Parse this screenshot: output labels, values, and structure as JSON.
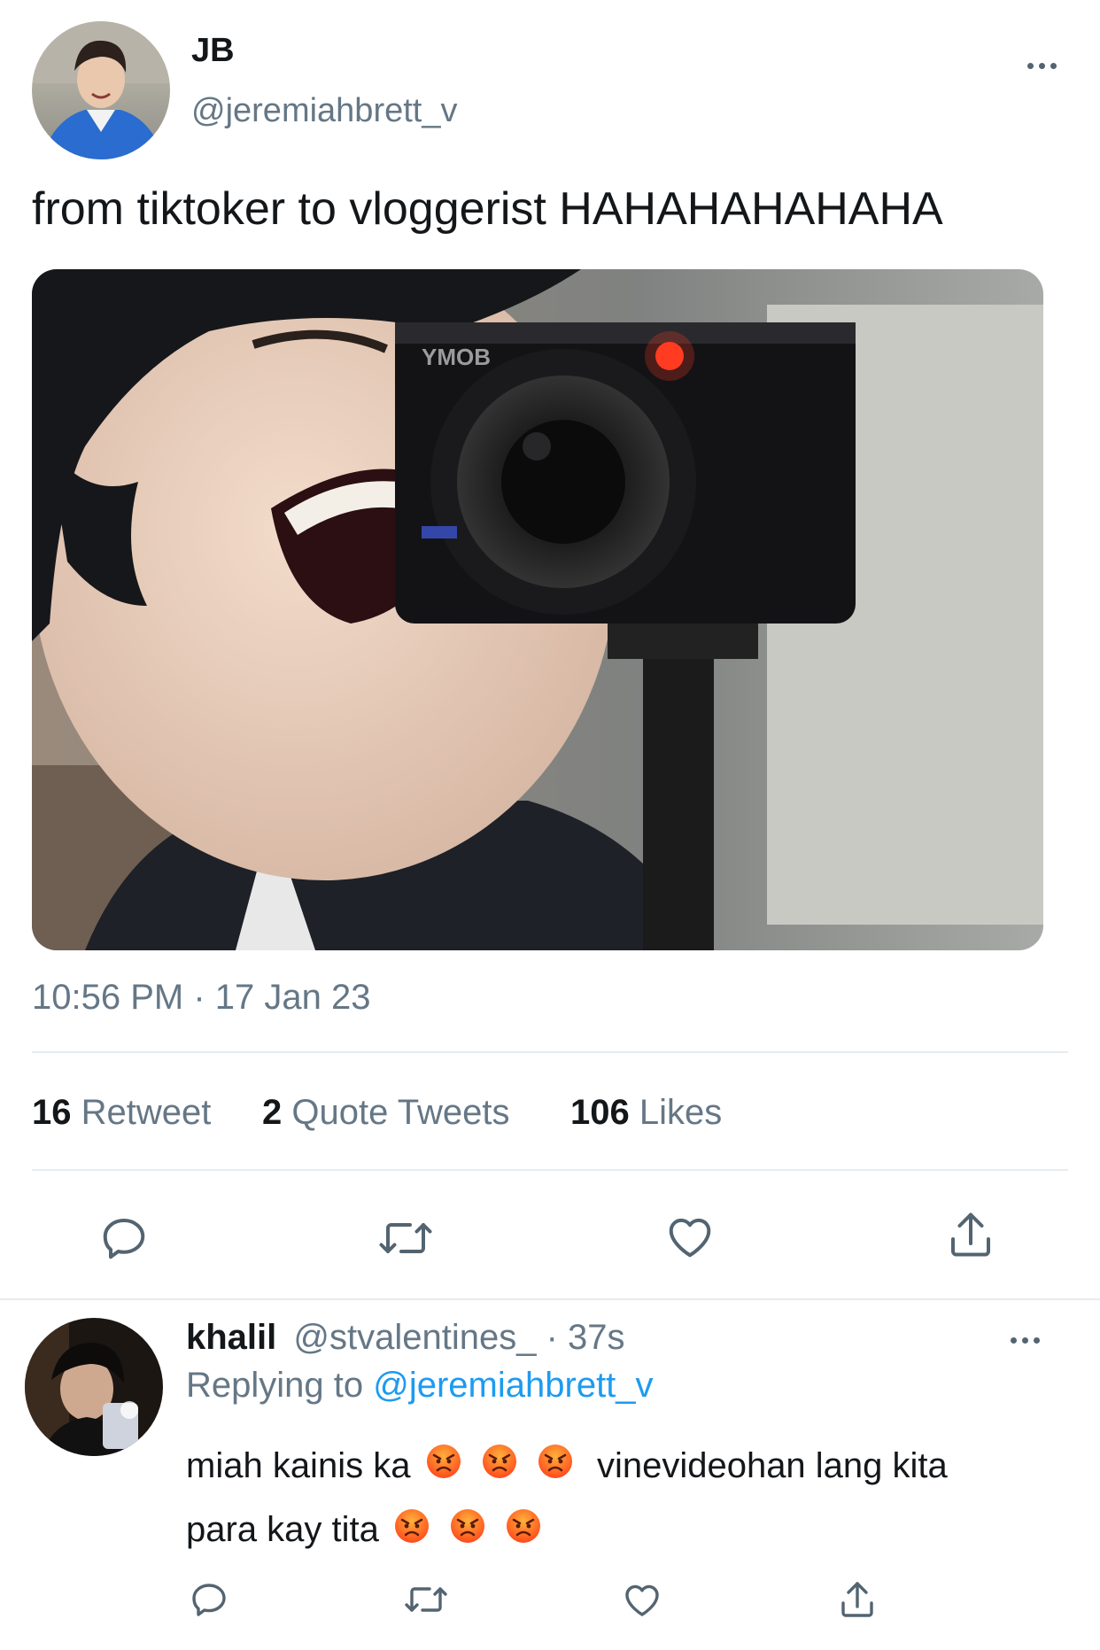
{
  "tweet": {
    "display_name": "JB",
    "handle": "@jeremiahbrett_v",
    "text": "from tiktoker to vloggerist HAHAHAHAHAHA",
    "camera_brand": "YMOB",
    "timestamp": "10:56 PM · 17 Jan 23",
    "stats": {
      "retweets_count": "16",
      "retweets_label": "Retweet",
      "quotes_count": "2",
      "quotes_label": "Quote Tweets",
      "likes_count": "106",
      "likes_label": "Likes"
    }
  },
  "reply": {
    "display_name": "khalil",
    "handle": "@stvalentines_",
    "time": "· 37s",
    "replying_prefix": "Replying to",
    "replying_handle": "@jeremiahbrett_v",
    "line1_start": "miah kainis ka",
    "line1_end": "vinevideohan lang kita",
    "line2_start": "para kay tita"
  },
  "icons": [
    "reply-icon",
    "retweet-icon",
    "like-icon",
    "share-icon",
    "more-icon",
    "angry-face-icon"
  ],
  "colors": {
    "text": "#14171a",
    "secondary": "#657786",
    "link": "#1d9bf0",
    "divider": "#e6ecf0"
  }
}
